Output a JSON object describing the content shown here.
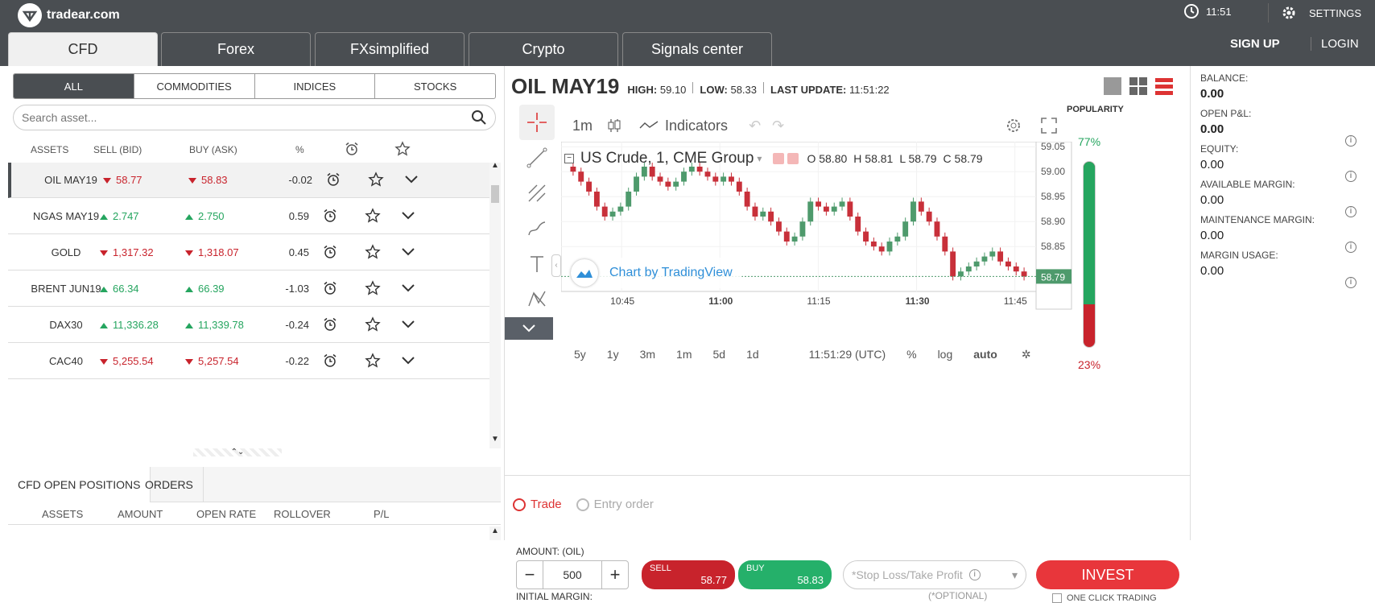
{
  "brand": {
    "name": "tradear.com"
  },
  "header": {
    "time": "11:51",
    "settings_label": "SETTINGS",
    "signup_label": "SIGN UP",
    "login_label": "LOGIN",
    "tabs": [
      {
        "label": "CFD",
        "active": true
      },
      {
        "label": "Forex",
        "active": false
      },
      {
        "label": "FXsimplified",
        "active": false
      },
      {
        "label": "Crypto",
        "active": false
      },
      {
        "label": "Signals center",
        "active": false
      }
    ]
  },
  "asset_list": {
    "filters": [
      {
        "label": "ALL",
        "active": true
      },
      {
        "label": "COMMODITIES",
        "active": false
      },
      {
        "label": "INDICES",
        "active": false
      },
      {
        "label": "STOCKS",
        "active": false
      }
    ],
    "search_placeholder": "Search asset...",
    "columns": {
      "assets": "ASSETS",
      "sell": "SELL (BID)",
      "buy": "BUY (ASK)",
      "pct": "%"
    },
    "rows": [
      {
        "name": "OIL MAY19",
        "sell": "58.77",
        "buy": "58.83",
        "pct": "-0.02",
        "dir": "down",
        "selected": true
      },
      {
        "name": "NGAS MAY19",
        "sell": "2.747",
        "buy": "2.750",
        "pct": "0.59",
        "dir": "up",
        "selected": false
      },
      {
        "name": "GOLD",
        "sell": "1,317.32",
        "buy": "1,318.07",
        "pct": "0.45",
        "dir": "down",
        "selected": false
      },
      {
        "name": "BRENT JUN19",
        "sell": "66.34",
        "buy": "66.39",
        "pct": "-1.03",
        "dir": "up",
        "selected": false
      },
      {
        "name": "DAX30",
        "sell": "11,336.28",
        "buy": "11,339.78",
        "pct": "-0.24",
        "dir": "up",
        "selected": false
      },
      {
        "name": "CAC40",
        "sell": "5,255.54",
        "buy": "5,257.54",
        "pct": "-0.22",
        "dir": "down",
        "selected": false
      }
    ]
  },
  "positions": {
    "tabs": [
      "CFD OPEN POSITIONS",
      "ORDERS"
    ],
    "columns": [
      "ASSETS",
      "AMOUNT",
      "OPEN RATE",
      "ROLLOVER",
      "P/L"
    ]
  },
  "asset": {
    "title": "OIL MAY19",
    "high_label": "HIGH:",
    "high": "59.10",
    "low_label": "LOW:",
    "low": "58.33",
    "update_label": "LAST UPDATE:",
    "update": "11:51:22"
  },
  "chart_toolbar": {
    "interval": "1m",
    "indicators": "Indicators",
    "legend_title": "US Crude, 1, CME Group",
    "o": "O 58.80",
    "h": "H 58.81",
    "l": "L 58.79",
    "c": "C 58.79",
    "watermark": "Chart by TradingView",
    "ranges": [
      "5y",
      "1y",
      "3m",
      "1m",
      "5d",
      "1d"
    ],
    "clock": "11:51:29 (UTC)",
    "pct": "%",
    "log": "log",
    "auto": "auto",
    "current_price": "58.79"
  },
  "chart_data": {
    "type": "candlestick",
    "x_ticks": [
      "10:45",
      "11:00",
      "11:15",
      "11:30",
      "11:45"
    ],
    "y_ticks": [
      "59.05",
      "59.00",
      "58.95",
      "58.90",
      "58.85"
    ],
    "ylim": [
      58.76,
      59.06
    ],
    "close": [
      59.0,
      58.98,
      58.96,
      58.93,
      58.91,
      58.92,
      58.93,
      58.96,
      58.99,
      59.01,
      58.99,
      58.98,
      58.97,
      58.98,
      59.0,
      59.01,
      59.0,
      58.99,
      58.98,
      58.99,
      58.98,
      58.96,
      58.93,
      58.91,
      58.92,
      58.9,
      58.88,
      58.86,
      58.87,
      58.9,
      58.94,
      58.93,
      58.92,
      58.93,
      58.94,
      58.91,
      58.88,
      58.86,
      58.85,
      58.84,
      58.86,
      58.87,
      58.9,
      58.94,
      58.92,
      58.9,
      58.87,
      58.84,
      58.79,
      58.8,
      58.81,
      58.82,
      58.83,
      58.84,
      58.82,
      58.81,
      58.8,
      58.79
    ],
    "popularity_sell": "77%",
    "popularity_buy": "23%",
    "popularity_label": "POPULARITY"
  },
  "trade": {
    "trade_label": "Trade",
    "entry_label": "Entry order",
    "amount_label": "AMOUNT: (OIL)",
    "amount": "500",
    "sell_label": "SELL",
    "sell_price": "58.77",
    "buy_label": "BUY",
    "buy_price": "58.83",
    "sltp_placeholder": "*Stop Loss/Take Profit",
    "optional": "(*OPTIONAL)",
    "invest_label": "INVEST",
    "initial_margin": "INITIAL MARGIN:",
    "one_click": "ONE CLICK TRADING"
  },
  "account": {
    "items": [
      {
        "label": "BALANCE:",
        "value": "0.00",
        "bold": true
      },
      {
        "label": "OPEN P&L:",
        "value": "0.00",
        "bold": true
      },
      {
        "label": "EQUITY:",
        "value": "0.00",
        "bold": false
      },
      {
        "label": "AVAILABLE MARGIN:",
        "value": "0.00",
        "bold": false
      },
      {
        "label": "MAINTENANCE MARGIN:",
        "value": "0.00",
        "bold": false
      },
      {
        "label": "MARGIN USAGE:",
        "value": "0.00",
        "bold": false
      }
    ]
  }
}
